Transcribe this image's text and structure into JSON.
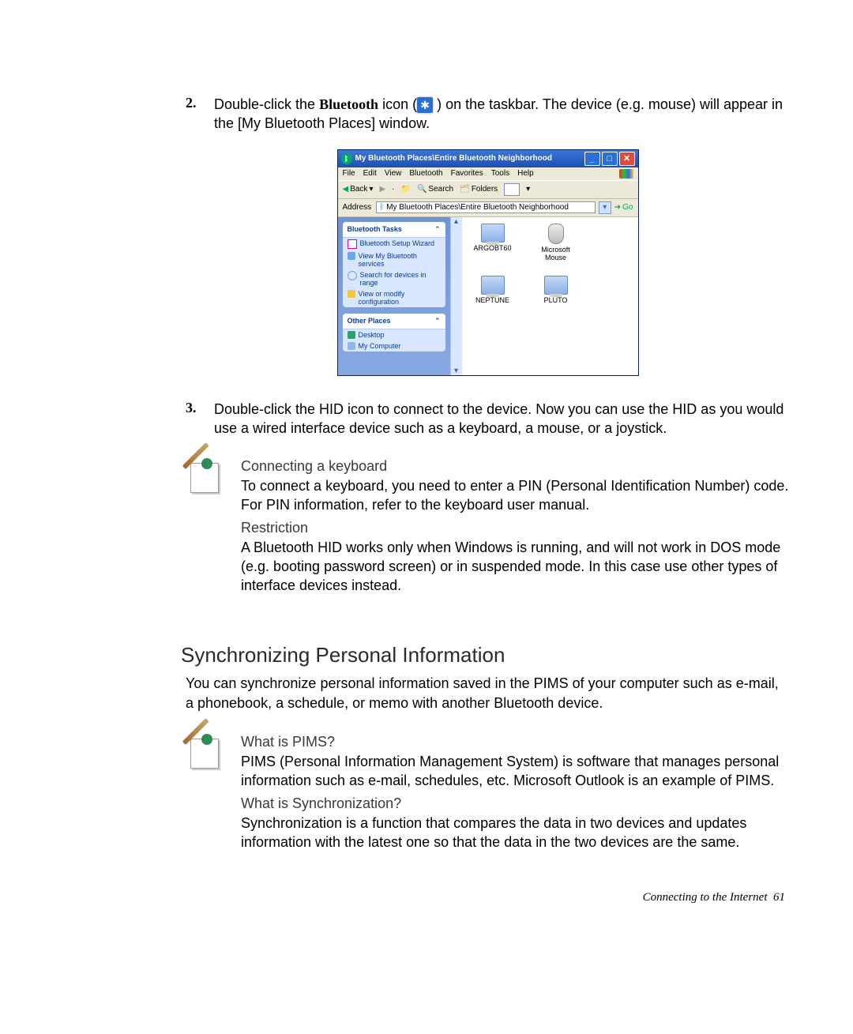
{
  "step2": {
    "num": "2.",
    "prefix": "Double-click the ",
    "bold": "Bluetooth",
    "mid": " icon (",
    "glyph": "✱",
    "suffix": " ) on the taskbar. The device (e.g. mouse) will appear in the [My Bluetooth Places] window."
  },
  "window": {
    "title": "My Bluetooth Places\\Entire Bluetooth Neighborhood",
    "menus": [
      "File",
      "Edit",
      "View",
      "Bluetooth",
      "Favorites",
      "Tools",
      "Help"
    ],
    "toolbar": {
      "back": "Back",
      "search": "Search",
      "folders": "Folders"
    },
    "address": {
      "label": "Address",
      "value": "My Bluetooth Places\\Entire Bluetooth Neighborhood",
      "go": "Go"
    },
    "tasks_panel": {
      "title": "Bluetooth Tasks",
      "items": [
        "Bluetooth Setup Wizard",
        "View My Bluetooth services",
        "Search for devices in range",
        "View or modify configuration"
      ]
    },
    "other_panel": {
      "title": "Other Places",
      "items": [
        "Desktop",
        "My Computer"
      ]
    },
    "devices": [
      "ARGOBT60",
      "Microsoft Mouse",
      "NEPTUNE",
      "PLUTO"
    ]
  },
  "step3": {
    "num": "3.",
    "text": "Double-click the HID icon to connect to the device. Now you can use the HID as you would use a wired interface device such as a keyboard, a mouse, or a joystick."
  },
  "note1": {
    "h1": "Connecting a keyboard",
    "t1": "To connect a keyboard, you need to enter a PIN (Personal Identification Number) code. For PIN information, refer to the keyboard user manual.",
    "h2": "Restriction",
    "t2": "A Bluetooth HID works only when Windows is running, and will not work in DOS mode (e.g. booting password screen) or in suspended mode. In this case use other types of interface devices instead."
  },
  "section": {
    "heading": "Synchronizing Personal Information",
    "intro": "You can synchronize personal information saved in the PIMS of your computer such as e-mail, a phonebook, a schedule, or memo with another Bluetooth device."
  },
  "note2": {
    "h1": "What is PIMS?",
    "t1": "PIMS (Personal Information Management System) is software that manages personal information such as e-mail, schedules, etc. Microsoft Outlook is an example of PIMS.",
    "h2": "What is Synchronization?",
    "t2": "Synchronization is a function that compares the data in two devices and updates information with the latest one so that the data in the two devices are the same."
  },
  "footer": "Connecting to the Internet  61"
}
